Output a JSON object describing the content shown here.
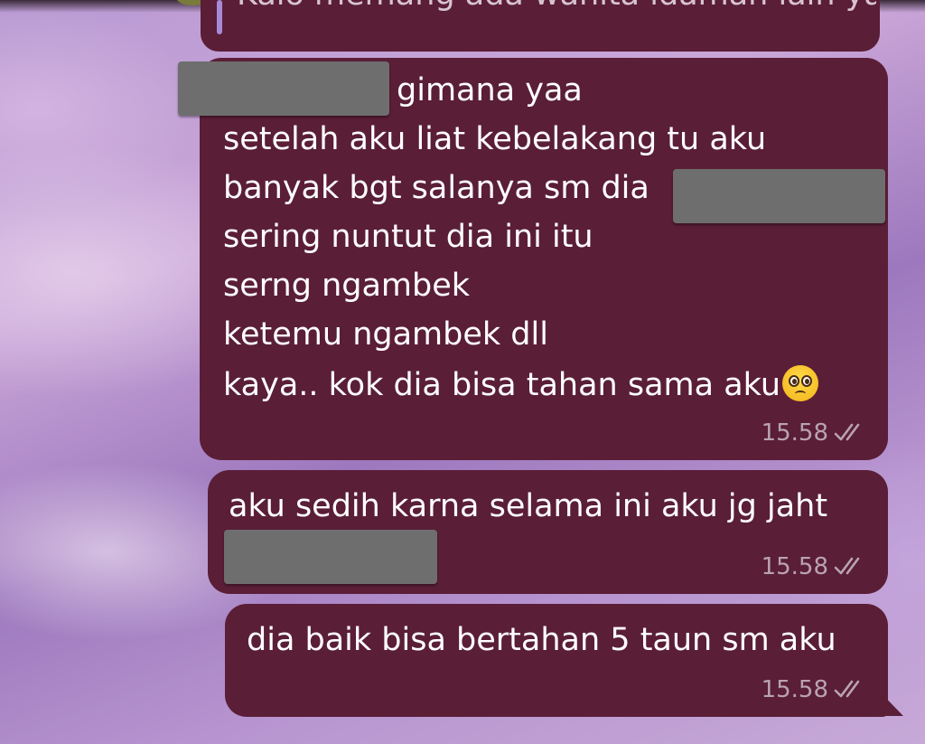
{
  "chat": {
    "quoted_preview": "Kalo memang ada wanita idaman lain ya silakan",
    "messages": [
      {
        "lines": [
          "gimana yaa",
          "setelah aku liat kebelakang tu aku",
          "banyak bgt salanya sm dia",
          "sering nuntut dia ini itu",
          "serng ngambek",
          "ketemu ngambek dll",
          "kaya.. kok dia bisa tahan sama aku"
        ],
        "emoji": "pleading-face",
        "time": "15.58",
        "status_icon": "double-check-icon"
      },
      {
        "lines": [
          "aku sedih karna selama ini aku jg jaht"
        ],
        "time": "15.58",
        "status_icon": "double-check-icon"
      },
      {
        "lines": [
          "dia baik bisa bertahan 5 taun sm aku"
        ],
        "time": "15.58",
        "status_icon": "double-check-icon"
      }
    ]
  },
  "colors": {
    "bubble": "#5a1e37",
    "text": "#ffffff",
    "meta": "#b9a3b0",
    "redaction": "#6e6e6e",
    "quote_bar": "#a78bd8"
  }
}
